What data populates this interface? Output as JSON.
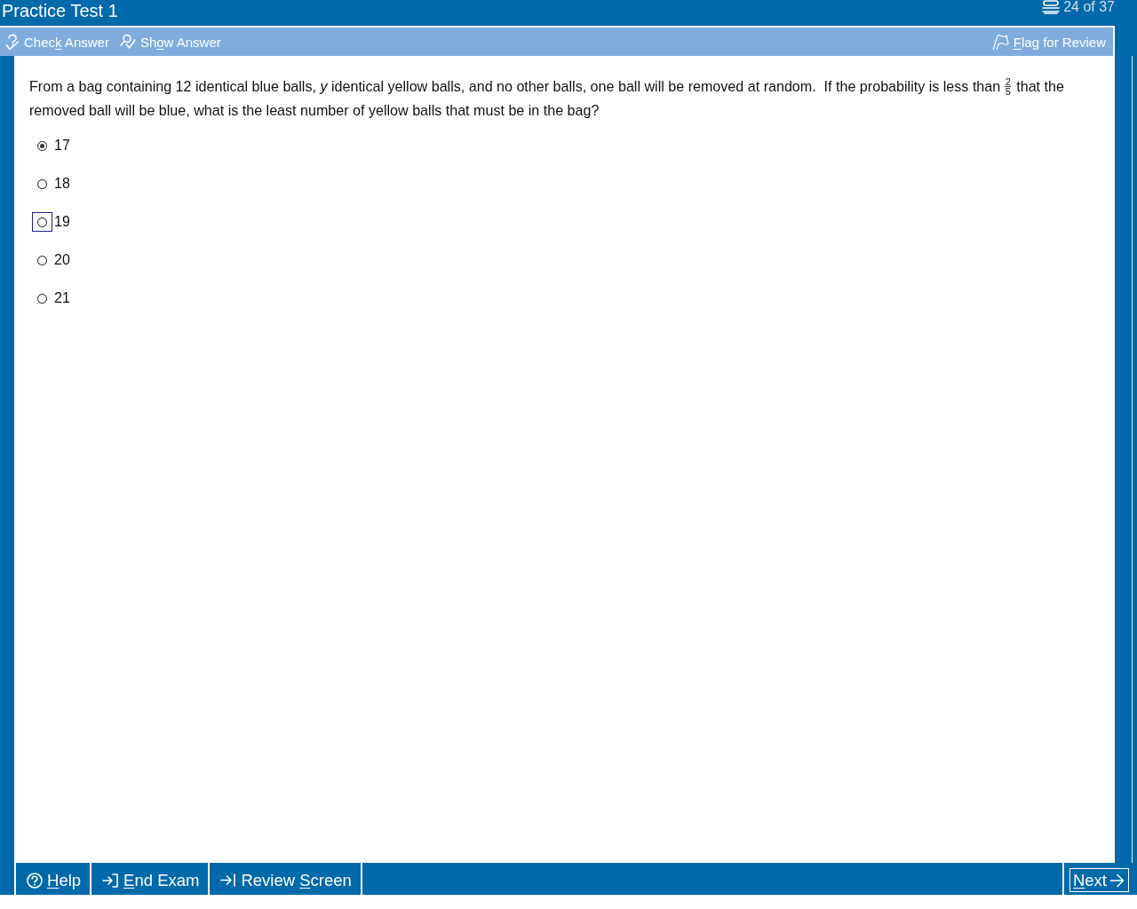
{
  "window": {
    "title": "Practice Test 1",
    "counter": "24 of 37"
  },
  "toolbar": {
    "left": [
      {
        "kind": "check",
        "pre": "Chec",
        "key": "k",
        "post": " Answer"
      },
      {
        "kind": "show",
        "pre": "Sh",
        "key": "o",
        "post": "w Answer"
      }
    ],
    "right": [
      {
        "kind": "flag",
        "key": "F",
        "post": "lag for Review"
      }
    ]
  },
  "question": {
    "before": "From a bag containing 12 identical blue balls, *y* identical yellow balls, and no other balls, one ball will be removed at random.  If the probability is less than",
    "fraction": {
      "numerator": "2",
      "denominator": "5"
    },
    "after": "that the removed ball will be blue, what is the least number of yellow balls that must be in the bag?"
  },
  "choices": [
    {
      "label": "17",
      "selected": true,
      "focused": false
    },
    {
      "label": "18",
      "selected": false,
      "focused": false
    },
    {
      "label": "19",
      "selected": false,
      "focused": true
    },
    {
      "label": "20",
      "selected": false,
      "focused": false
    },
    {
      "label": "21",
      "selected": false,
      "focused": false
    }
  ],
  "footer": {
    "left": [
      {
        "kind": "help",
        "key": "H",
        "post": "elp"
      },
      {
        "kind": "end",
        "key": "E",
        "post": "nd Exam"
      },
      {
        "kind": "review",
        "pre": "Review ",
        "key": "S",
        "post": "creen"
      }
    ],
    "right": [
      {
        "kind": "next",
        "key": "N",
        "post": "ext"
      }
    ]
  }
}
